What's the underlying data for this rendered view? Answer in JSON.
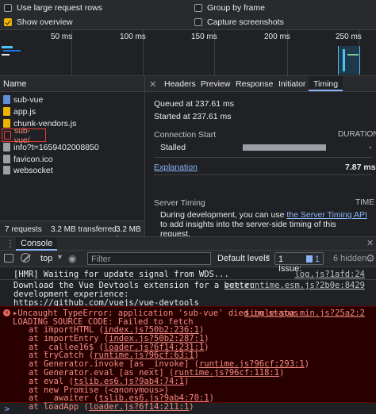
{
  "options": {
    "large_rows": "Use large request rows",
    "group_by_frame": "Group by frame",
    "show_overview": "Show overview",
    "capture_screenshots": "Capture screenshots"
  },
  "overview": {
    "ticks": [
      "50 ms",
      "100 ms",
      "150 ms",
      "200 ms",
      "250 ms"
    ]
  },
  "list": {
    "header": "Name",
    "items": [
      "sub-vue",
      "app.js",
      "chunk-vendors.js",
      "sub-vue/",
      "info?t=1659402008850",
      "favicon.ico",
      "websocket"
    ],
    "status": {
      "requests": "7 requests",
      "transferred": "3.2 MB transferred",
      "resources": "3.2 MB r"
    }
  },
  "tabs": [
    "Headers",
    "Preview",
    "Response",
    "Initiator",
    "Timing"
  ],
  "timing": {
    "queued": "Queued at 237.61 ms",
    "started": "Started at 237.61 ms",
    "conn_start": "Connection Start",
    "duration": "DURATION",
    "stalled": "Stalled",
    "stalled_val": "-",
    "explanation": "Explanation",
    "total": "7.87 ms",
    "server_timing": "Server Timing",
    "time": "TIME",
    "server_note_pre": "During development, you can use ",
    "server_note_link": "the Server Timing API",
    "server_note_post": " to add insights into the server-side timing of this request."
  },
  "console": {
    "tab": "Console",
    "context": "top",
    "filter_placeholder": "Filter",
    "levels": "Default levels",
    "issues": "1 Issue:",
    "issues_count": "1",
    "hidden": "6 hidden"
  },
  "messages": {
    "hmr": "[HMR] Waiting for update signal from WDS...",
    "hmr_src": "log.js?1afd:24",
    "devtools_1": "Download the Vue Devtools extension for a better",
    "devtools_2": "development experience:",
    "devtools_src": "vue.runtime.esm.js?2b0e:8429",
    "devtools_link": "https://github.com/vuejs/vue-devtools",
    "err_head": "▸Uncaught TypeError: application 'sub-vue' died in status",
    "err_src": "single-spa.min.js?25a2:2",
    "err_line2": "LOADING_SOURCE_CODE: Failed to fetch",
    "stack": [
      {
        "pre": "at importHTML (",
        "link": "index.js?50b2:236:1",
        "post": ")"
      },
      {
        "pre": "at importEntry (",
        "link": "index.js?50b2:287:1",
        "post": ")"
      },
      {
        "pre": "at _callee16$ (",
        "link": "loader.js?6f14:231:1",
        "post": ")"
      },
      {
        "pre": "at tryCatch (",
        "link": "runtime.js?96cf:63:1",
        "post": ")"
      },
      {
        "pre": "at Generator.invoke [as _invoke] (",
        "link": "runtime.js?96cf:293:1",
        "post": ")"
      },
      {
        "pre": "at Generator.eval [as next] (",
        "link": "runtime.js?96cf:118:1",
        "post": ")"
      },
      {
        "pre": "at eval (",
        "link": "tslib.es6.js?9ab4:74:1",
        "post": ")"
      },
      {
        "pre": "at new Promise (<anonymous>)",
        "link": "",
        "post": ""
      },
      {
        "pre": "at __awaiter (",
        "link": "tslib.es6.js?9ab4:70:1",
        "post": ")"
      },
      {
        "pre": "at loadApp (",
        "link": "loader.js?6f14:211:1",
        "post": ")"
      }
    ],
    "prompt": ">"
  },
  "colors": {
    "accent": "#8ab4f8",
    "error": "#f28b82",
    "check": "#f0b400"
  }
}
